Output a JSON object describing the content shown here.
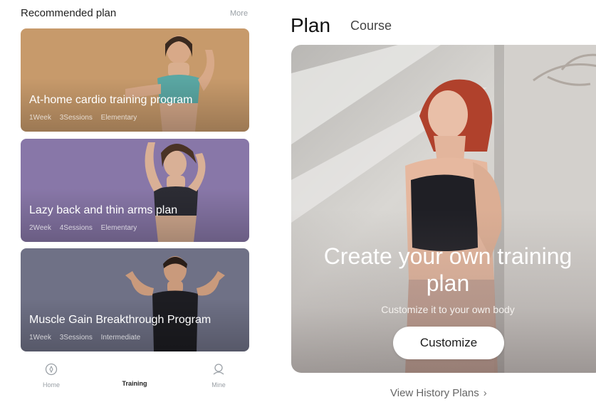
{
  "recommended": {
    "title": "Recommended plan",
    "more": "More",
    "cards": [
      {
        "title": "At-home cardio training program",
        "meta": [
          "1Week",
          "3Sessions",
          "Elementary"
        ],
        "color": "#c79a6b"
      },
      {
        "title": "Lazy back and thin arms plan",
        "meta": [
          "2Week",
          "4Sessions",
          "Elementary"
        ],
        "color": "#8877a8"
      },
      {
        "title": "Muscle Gain Breakthrough Program",
        "meta": [
          "1Week",
          "3Sessions",
          "Intermediate"
        ],
        "color": "#6f7186"
      }
    ]
  },
  "tabbar": {
    "items": [
      {
        "label": "Home",
        "icon": "home-compass-icon",
        "active": false
      },
      {
        "label": "Training",
        "icon": "training-icon",
        "active": true
      },
      {
        "label": "Mine",
        "icon": "person-icon",
        "active": false
      }
    ]
  },
  "right": {
    "tabs": [
      "Plan",
      "Course"
    ],
    "hero_title_line1": "Create your own training",
    "hero_title_line2": "plan",
    "hero_subtitle": "Customize it to your own body",
    "hero_button": "Customize",
    "history_link": "View History Plans",
    "history_icon": "chevron-right-icon"
  }
}
